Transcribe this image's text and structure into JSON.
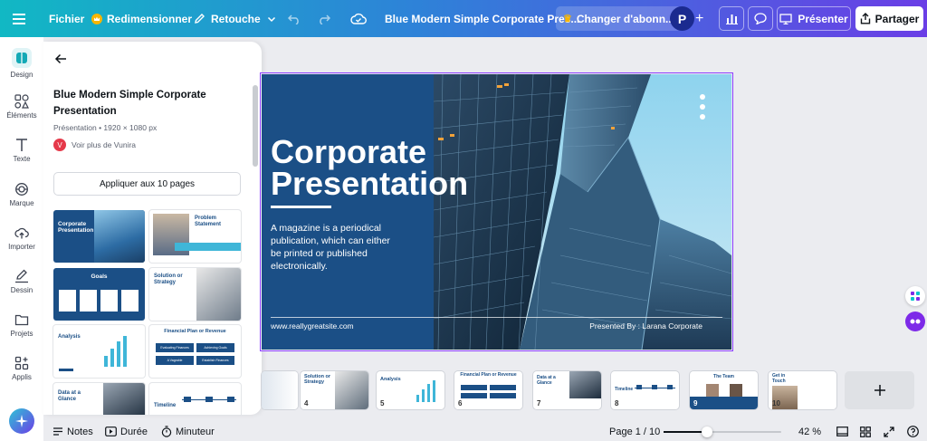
{
  "topbar": {
    "menu_label": "Fichier",
    "resize_label": "Redimensionner",
    "edit_label": "Retouche",
    "doc_title": "Blue Modern Simple Corporate Pres...",
    "upgrade_label": "Changer d'abonn...",
    "avatar_letter": "P",
    "present_label": "Présenter",
    "share_label": "Partager"
  },
  "sidebar": {
    "items": [
      {
        "label": "Design",
        "icon": "design-icon"
      },
      {
        "label": "Éléments",
        "icon": "elements-icon"
      },
      {
        "label": "Texte",
        "icon": "text-icon"
      },
      {
        "label": "Marque",
        "icon": "brand-icon"
      },
      {
        "label": "Importer",
        "icon": "upload-icon"
      },
      {
        "label": "Dessin",
        "icon": "draw-icon"
      },
      {
        "label": "Projets",
        "icon": "folder-icon"
      },
      {
        "label": "Applis",
        "icon": "apps-icon"
      }
    ]
  },
  "panel": {
    "title_line1": "Blue Modern Simple Corporate",
    "title_line2": "Presentation",
    "meta": "Présentation • 1920 × 1080 px",
    "author_initial": "V",
    "author_link": "Voir plus de Vunira",
    "apply_button": "Appliquer aux 10 pages",
    "templates": {
      "t1_title": "Corporate Presentation",
      "t2_title": "Problem Statement",
      "t3_title": "Goals",
      "t4_title": "Solution or Strategy",
      "t5_title": "Analysis",
      "t6_title": "Financial Plan or Revenue",
      "t6_cell1": "Evaluating Finances",
      "t6_cell2": "Achieving Goals",
      "t6_cell3": "A Vagrable",
      "t6_cell4": "Establish Finances",
      "t7_title": "Data at a Glance",
      "t8_title": "Timeline"
    }
  },
  "slide": {
    "title_line1": "Corporate",
    "title_line2": "Presentation",
    "body_line1": "A magazine is a periodical",
    "body_line2": "publication, which can either",
    "body_line3": "be printed or published",
    "body_line4": "electronically.",
    "website": "www.reallygreatsite.com",
    "presented_by": "Presented By : Larana Corporate"
  },
  "thumbnails": [
    {
      "num": "4",
      "title": "Solution or Strategy"
    },
    {
      "num": "5",
      "title": "Analysis"
    },
    {
      "num": "6",
      "title": "Financial Plan or Revenue"
    },
    {
      "num": "7",
      "title": "Data at a Glance"
    },
    {
      "num": "8",
      "title": "Timeline"
    },
    {
      "num": "9",
      "title": "The Team"
    },
    {
      "num": "10",
      "title": "Get in Touch"
    }
  ],
  "bottombar": {
    "notes": "Notes",
    "duration": "Durée",
    "timer": "Minuteur",
    "page": "Page 1 / 10",
    "zoom": "42 %",
    "zoom_level": 0.42
  },
  "colors": {
    "slide_blue": "#1b4f86",
    "accent_purple": "#7d2ae8",
    "brand_teal": "#00c4cc"
  }
}
